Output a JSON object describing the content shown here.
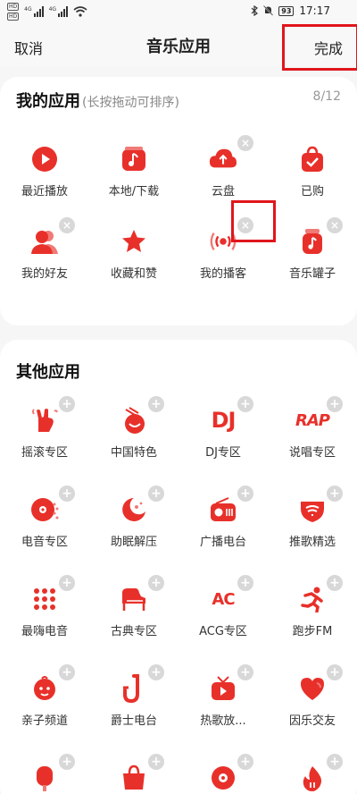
{
  "status_bar": {
    "network_tags": [
      "4G",
      "4G"
    ],
    "hd_labels": [
      "HD",
      "HD"
    ],
    "battery": "93",
    "time": "17:17"
  },
  "header": {
    "cancel_label": "取消",
    "title": "音乐应用",
    "done_label": "完成"
  },
  "my_apps": {
    "title": "我的应用",
    "hint": "(长按拖动可排序)",
    "count": "8/12",
    "items": [
      {
        "label": "最近播放",
        "icon": "play-icon",
        "removable": false
      },
      {
        "label": "本地/下载",
        "icon": "music-note-icon",
        "removable": false
      },
      {
        "label": "云盘",
        "icon": "cloud-upload-icon",
        "removable": true
      },
      {
        "label": "已购",
        "icon": "purchased-bag-icon",
        "removable": false
      },
      {
        "label": "我的好友",
        "icon": "friends-icon",
        "removable": true
      },
      {
        "label": "收藏和赞",
        "icon": "star-icon",
        "removable": false
      },
      {
        "label": "我的播客",
        "icon": "podcast-icon",
        "removable": true
      },
      {
        "label": "音乐罐子",
        "icon": "music-jar-icon",
        "removable": true
      }
    ]
  },
  "other_apps": {
    "title": "其他应用",
    "items": [
      {
        "label": "摇滚专区",
        "icon": "rock-hand-icon"
      },
      {
        "label": "中国特色",
        "icon": "chinese-drum-icon"
      },
      {
        "label": "DJ专区",
        "icon": "dj-icon",
        "glyph": "DJ"
      },
      {
        "label": "说唱专区",
        "icon": "rap-icon",
        "glyph": "RAP"
      },
      {
        "label": "电音专区",
        "icon": "vinyl-icon"
      },
      {
        "label": "助眠解压",
        "icon": "moon-icon"
      },
      {
        "label": "广播电台",
        "icon": "radio-icon"
      },
      {
        "label": "推歌精选",
        "icon": "recommend-icon"
      },
      {
        "label": "最嗨电音",
        "icon": "dots-grid-icon"
      },
      {
        "label": "古典专区",
        "icon": "piano-icon"
      },
      {
        "label": "ACG专区",
        "icon": "acg-icon",
        "glyph": "AC"
      },
      {
        "label": "跑步FM",
        "icon": "running-icon"
      },
      {
        "label": "亲子频道",
        "icon": "kid-face-icon"
      },
      {
        "label": "爵士电台",
        "icon": "saxophone-icon"
      },
      {
        "label": "热歌放...",
        "icon": "tv-icon"
      },
      {
        "label": "因乐交友",
        "icon": "heart-chat-icon"
      },
      {
        "label": "",
        "icon": "popsicle-icon"
      },
      {
        "label": "",
        "icon": "bag-icon"
      },
      {
        "label": "",
        "icon": "eye-icon"
      },
      {
        "label": "",
        "icon": "fire-icon"
      }
    ]
  },
  "colors": {
    "accent": "#e8302a",
    "highlight": "#e0161c",
    "badge": "#d8d8d8"
  }
}
